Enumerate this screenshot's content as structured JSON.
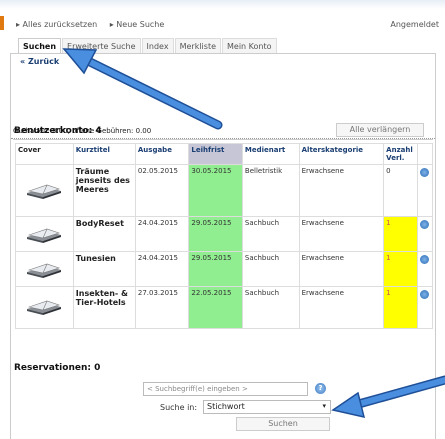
{
  "top": {
    "links": [
      "▸ Alles zurücksetzen",
      "▸ Neue Suche"
    ],
    "login": "Angemeldet"
  },
  "tabs": [
    "Suchen",
    "Erweiterte Suche",
    "Index",
    "Merkliste",
    "Mein Konto"
  ],
  "back": "« Zurück",
  "credit": "Guthaben: 0.00, offene Gebühren: 0.00",
  "account_title": "Benutzerkonto: 4",
  "renew_all": "Alle verlängern",
  "table": {
    "headers": [
      "Cover",
      "Kurztitel",
      "Ausgabe",
      "Leihfrist",
      "Medienart",
      "Alterskategorie",
      "Anzahl Verl."
    ],
    "rows": [
      {
        "title": "Träume jenseits des Meeres",
        "ausgabe": "02.05.2015",
        "leihfrist": "30.05.2015",
        "medienart": "Belletristik",
        "alter": "Erwachsene",
        "anzahl": "0"
      },
      {
        "title": "BodyReset",
        "ausgabe": "24.04.2015",
        "leihfrist": "29.05.2015",
        "medienart": "Sachbuch",
        "alter": "Erwachsene",
        "anzahl": "1"
      },
      {
        "title": "Tunesien",
        "ausgabe": "24.04.2015",
        "leihfrist": "29.05.2015",
        "medienart": "Sachbuch",
        "alter": "Erwachsene",
        "anzahl": "1"
      },
      {
        "title": "Insekten- & Tier-Hotels",
        "ausgabe": "27.03.2015",
        "leihfrist": "22.05.2015",
        "medienart": "Sachbuch",
        "alter": "Erwachsene",
        "anzahl": "1"
      }
    ]
  },
  "reservations": "Reservationen: 0",
  "search": {
    "placeholder": "< Suchbegriff(e) eingeben >",
    "in_label": "Suche in:",
    "in_value": "Stichwort",
    "button": "Suchen"
  },
  "colors": {
    "accent": "#e07a10",
    "link": "#1a3e72",
    "leihfrist": "#90ee90",
    "highlight": "#ffff00",
    "arrow": "#3a7bd5"
  },
  "icons": {
    "book": "open-book-icon",
    "renew": "renew-icon",
    "help": "help-icon"
  }
}
